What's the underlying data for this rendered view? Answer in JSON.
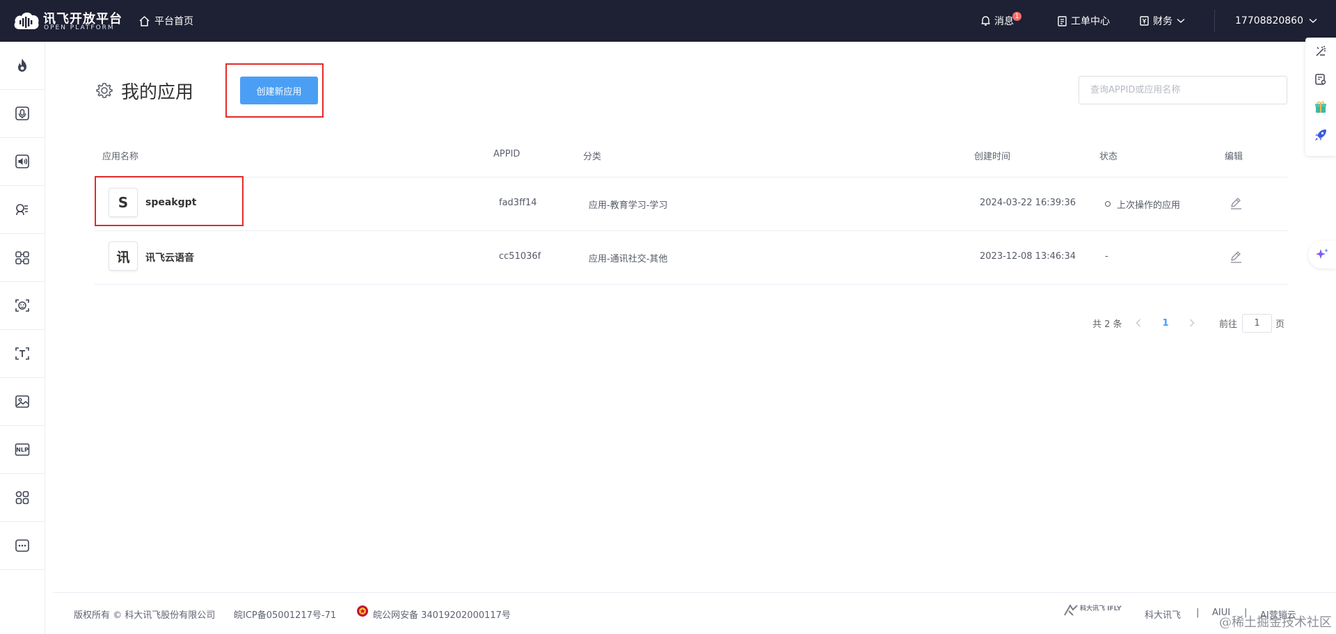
{
  "brand": {
    "title": "讯飞开放平台",
    "subtitle": "OPEN PLATFORM",
    "accent": "#4a9ff5",
    "nav_bg": "#1e2033"
  },
  "topnav": {
    "home_label": "平台首页",
    "messages_label": "消息",
    "messages_badge": "1",
    "tickets_label": "工单中心",
    "finance_label": "财务",
    "account_label": "17708820860"
  },
  "sidebar": {
    "items": [
      {
        "icon": "flame-icon"
      },
      {
        "icon": "microphone-icon"
      },
      {
        "icon": "speaker-icon"
      },
      {
        "icon": "voice-recognition-icon"
      },
      {
        "icon": "compare-icon"
      },
      {
        "icon": "face-icon"
      },
      {
        "icon": "text-recognition-icon"
      },
      {
        "icon": "image-icon"
      },
      {
        "icon": "nlp-icon",
        "text": "NLP"
      },
      {
        "icon": "apps-grid-icon"
      },
      {
        "icon": "more-icon"
      }
    ]
  },
  "page": {
    "title": "我的应用",
    "create_button": "创建新应用",
    "search_placeholder": "查询APPID或应用名称"
  },
  "table": {
    "headers": {
      "name": "应用名称",
      "appid": "APPID",
      "category": "分类",
      "created": "创建时间",
      "status": "状态",
      "edit": "编辑"
    },
    "rows": [
      {
        "avatar": "S",
        "name": "speakgpt",
        "appid": "fad3ff14",
        "category": "应用-教育学习-学习",
        "created": "2024-03-22 16:39:36",
        "status": "上次操作的应用"
      },
      {
        "avatar": "讯",
        "name": "讯飞云语音",
        "appid": "cc51036f",
        "category": "应用-通讯社交-其他",
        "created": "2023-12-08 13:46:34",
        "status": "-"
      }
    ]
  },
  "pagination": {
    "total": "共 2 条",
    "current": "1",
    "goto_prefix": "前往",
    "goto_value": "1",
    "goto_suffix": "页"
  },
  "footer": {
    "copyright": "版权所有 © 科大讯飞股份有限公司",
    "icp": "皖ICP备05001217号-71",
    "police": "皖公网安备 34019202000117号",
    "iflytek_logo_text": "科大讯飞 IFLYTEK",
    "links": [
      "科大讯飞",
      "AIUI",
      "AI营销云"
    ],
    "separator": "|",
    "watermark": "@稀土掘金技术社区"
  }
}
